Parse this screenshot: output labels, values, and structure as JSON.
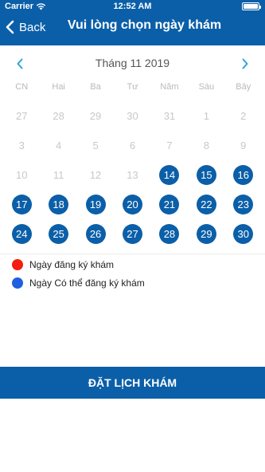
{
  "status_bar": {
    "carrier": "Carrier",
    "time": "12:52 AM"
  },
  "nav": {
    "back_label": "Back",
    "title": "Vui lòng chọn ngày khám"
  },
  "calendar": {
    "month_label": "Tháng 11 2019",
    "weekdays": [
      "CN",
      "Hai",
      "Ba",
      "Tư",
      "Năm",
      "Sáu",
      "Bảy"
    ],
    "days": [
      {
        "label": "27",
        "state": "disabled"
      },
      {
        "label": "28",
        "state": "disabled"
      },
      {
        "label": "29",
        "state": "disabled"
      },
      {
        "label": "30",
        "state": "disabled"
      },
      {
        "label": "31",
        "state": "disabled"
      },
      {
        "label": "1",
        "state": "disabled"
      },
      {
        "label": "2",
        "state": "disabled"
      },
      {
        "label": "3",
        "state": "disabled"
      },
      {
        "label": "4",
        "state": "disabled"
      },
      {
        "label": "5",
        "state": "disabled"
      },
      {
        "label": "6",
        "state": "disabled"
      },
      {
        "label": "7",
        "state": "disabled"
      },
      {
        "label": "8",
        "state": "disabled"
      },
      {
        "label": "9",
        "state": "disabled"
      },
      {
        "label": "10",
        "state": "disabled"
      },
      {
        "label": "11",
        "state": "disabled"
      },
      {
        "label": "12",
        "state": "disabled"
      },
      {
        "label": "13",
        "state": "disabled"
      },
      {
        "label": "14",
        "state": "available"
      },
      {
        "label": "15",
        "state": "available"
      },
      {
        "label": "16",
        "state": "available"
      },
      {
        "label": "17",
        "state": "available"
      },
      {
        "label": "18",
        "state": "available"
      },
      {
        "label": "19",
        "state": "available"
      },
      {
        "label": "20",
        "state": "available"
      },
      {
        "label": "21",
        "state": "available"
      },
      {
        "label": "22",
        "state": "available"
      },
      {
        "label": "23",
        "state": "available"
      },
      {
        "label": "24",
        "state": "available"
      },
      {
        "label": "25",
        "state": "available"
      },
      {
        "label": "26",
        "state": "available"
      },
      {
        "label": "27",
        "state": "available"
      },
      {
        "label": "28",
        "state": "available"
      },
      {
        "label": "29",
        "state": "available"
      },
      {
        "label": "30",
        "state": "available"
      }
    ]
  },
  "legend": {
    "registered_label": "Ngày đăng ký khám",
    "available_label": "Ngày Có thể đăng ký khám",
    "registered_color": "#f51d0f",
    "available_color": "#1f5fe0"
  },
  "book_button_label": "ĐẶT LỊCH KHÁM",
  "colors": {
    "primary": "#0b5fa8",
    "accent_arrow": "#2aa5d6"
  }
}
